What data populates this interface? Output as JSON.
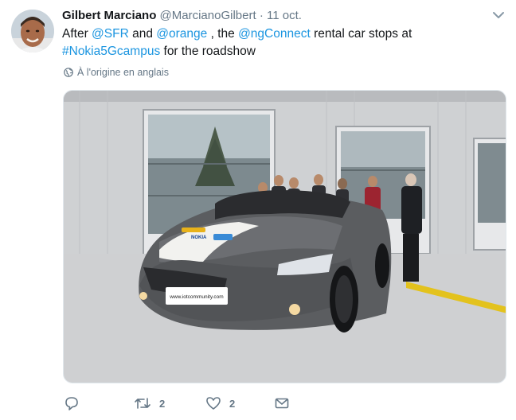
{
  "tweet": {
    "name": "Gilbert Marciano",
    "handle": "@MarcianoGilbert",
    "separator": "·",
    "date": "11 oct.",
    "text": {
      "t1": "After ",
      "l1": "@SFR",
      "t2": " and ",
      "l2": "@orange",
      "t3": " , the ",
      "l3": "@ngConnect",
      "t4": " rental car stops at",
      "l4": "#Nokia5Gcampus",
      "t5": " for the roadshow"
    },
    "translate_label": "À l'origine en anglais",
    "media": {
      "plate_text": "www.iotcommunity.com",
      "hood_brand": "NOKIA"
    }
  },
  "actions": {
    "reply_icon": "reply-icon",
    "retweet_icon": "retweet-icon",
    "retweet_count": "2",
    "like_icon": "heart-icon",
    "like_count": "2",
    "dm_icon": "envelope-icon"
  },
  "colors": {
    "link": "#1b95e0",
    "muted": "#657786",
    "text": "#14171a"
  }
}
